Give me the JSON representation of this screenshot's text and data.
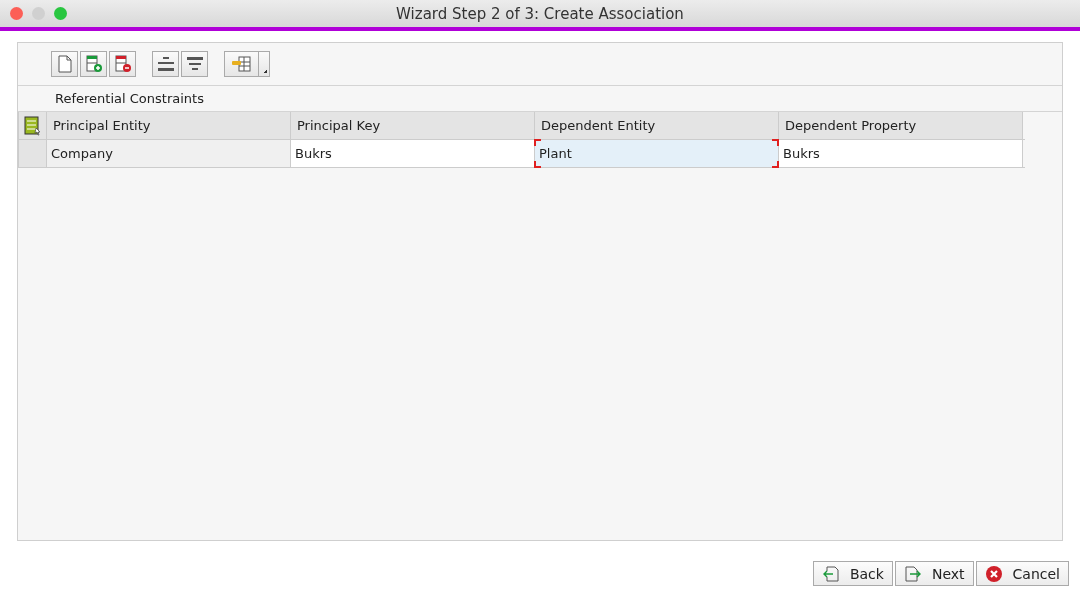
{
  "window": {
    "title": "Wizard Step 2 of 3: Create Association"
  },
  "toolbar": [
    [
      {
        "kind": "new"
      },
      {
        "kind": "insert-row"
      },
      {
        "kind": "delete-row"
      }
    ],
    [
      {
        "kind": "center"
      },
      {
        "kind": "filter"
      }
    ],
    [
      {
        "kind": "key-menu"
      }
    ]
  ],
  "section": {
    "title": "Referential Constraints"
  },
  "table": {
    "columns": [
      "Principal Entity",
      "Principal Key",
      "Dependent Entity",
      "Dependent Property"
    ],
    "rows": [
      {
        "cells": [
          {
            "text": "Company",
            "editable": false,
            "selected": false
          },
          {
            "text": "Bukrs",
            "editable": true,
            "selected": false
          },
          {
            "text": "Plant",
            "editable": true,
            "selected": true
          },
          {
            "text": "Bukrs",
            "editable": true,
            "selected": false
          }
        ]
      }
    ]
  },
  "buttons": [
    {
      "label": "Back",
      "kind": "back"
    },
    {
      "label": "Next",
      "kind": "next"
    },
    {
      "label": "Cancel",
      "kind": "cancel"
    }
  ]
}
